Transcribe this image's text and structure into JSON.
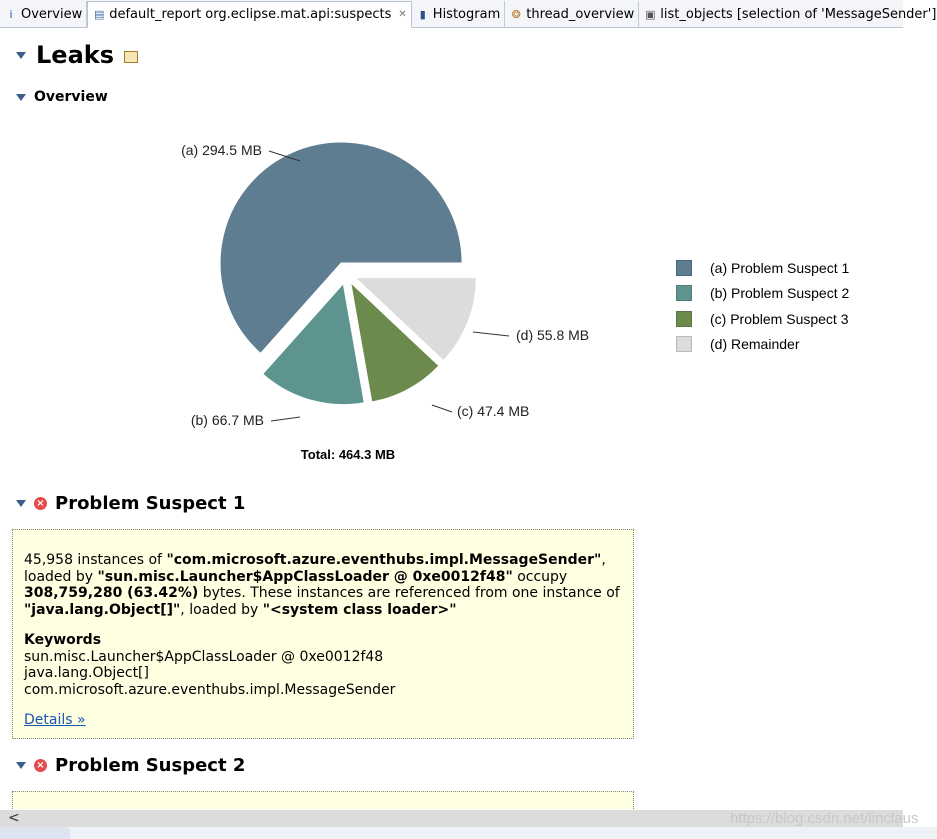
{
  "tabs": [
    {
      "icon": "info-icon",
      "label": "Overview",
      "active": false
    },
    {
      "icon": "report-icon",
      "label": "default_report  org.eclipse.mat.api:suspects",
      "active": true,
      "close": "✕"
    },
    {
      "icon": "histogram-icon",
      "label": "Histogram",
      "active": false
    },
    {
      "icon": "thread-icon",
      "label": "thread_overview",
      "active": false
    },
    {
      "icon": "list-icon",
      "label": "list_objects [selection of 'MessageSender']",
      "active": false
    }
  ],
  "report": {
    "title": "Leaks",
    "overview_title": "Overview"
  },
  "chart_data": {
    "type": "pie",
    "slices": [
      {
        "key": "(a)",
        "label": "(a) 294.5 MB",
        "value": 294.5,
        "legend": "(a)  Problem Suspect 1",
        "color": "#5f7d91"
      },
      {
        "key": "(b)",
        "label": "(b) 66.7 MB",
        "value": 66.7,
        "legend": "(b)  Problem Suspect 2",
        "color": "#5e9490"
      },
      {
        "key": "(c)",
        "label": "(c) 47.4 MB",
        "value": 47.4,
        "legend": "(c)  Problem Suspect 3",
        "color": "#6b8a4c"
      },
      {
        "key": "(d)",
        "label": "(d) 55.8 MB",
        "value": 55.8,
        "legend": "(d)  Remainder",
        "color": "#dcdcdc"
      }
    ],
    "total": "Total: 464.3 MB",
    "legend_position": "right"
  },
  "suspect1": {
    "title": "Problem Suspect 1",
    "desc": [
      {
        "t": "45,958 instances of ",
        "b": false
      },
      {
        "t": "\"com.microsoft.azure.eventhubs.impl.MessageSender\"",
        "b": true
      },
      {
        "t": ", loaded by ",
        "b": false
      },
      {
        "t": "\"sun.misc.Launcher$AppClassLoader @ 0xe0012f48\"",
        "b": true
      },
      {
        "t": " occupy ",
        "b": false
      },
      {
        "t": "308,759,280 (63.42%)",
        "b": true
      },
      {
        "t": " bytes. These instances are referenced from one instance of ",
        "b": false
      },
      {
        "t": "\"java.lang.Object[]\"",
        "b": true
      },
      {
        "t": ", loaded by ",
        "b": false
      },
      {
        "t": "\"<system class loader>\"",
        "b": true
      }
    ],
    "keywords_title": "Keywords",
    "keywords": [
      "sun.misc.Launcher$AppClassLoader @ 0xe0012f48",
      "java.lang.Object[]",
      "com.microsoft.azure.eventhubs.impl.MessageSender"
    ],
    "details_link": "Details »"
  },
  "suspect2": {
    "title": "Problem Suspect 2"
  },
  "watermark": "https://blog.csdn.net/linclaus",
  "scroll_left_arrow": "<"
}
